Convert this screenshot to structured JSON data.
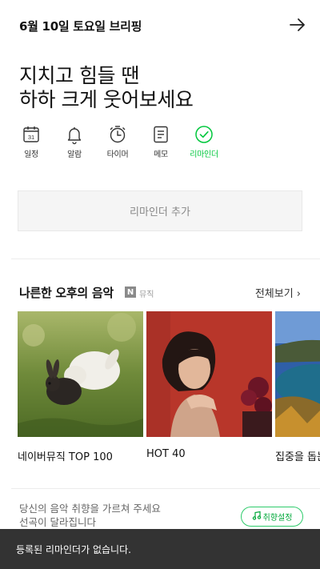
{
  "header": {
    "title": "6월 10일 토요일 브리핑",
    "icon": "arrow-right-icon"
  },
  "greeting": {
    "line1": "지치고 힘들 땐",
    "line2": "하하 크게 웃어보세요"
  },
  "tabs": [
    {
      "label": "일정",
      "icon": "calendar-icon",
      "calendar_day": "31"
    },
    {
      "label": "알람",
      "icon": "bell-icon"
    },
    {
      "label": "타이머",
      "icon": "timer-icon"
    },
    {
      "label": "메모",
      "icon": "memo-icon"
    },
    {
      "label": "리마인더",
      "icon": "check-circle-icon",
      "active": true
    }
  ],
  "reminder": {
    "add_label": "리마인더 추가"
  },
  "music": {
    "title": "나른한 오후의 음악",
    "badge": "N",
    "source": "뮤직",
    "view_all": "전체보기",
    "cards": [
      {
        "title": "네이버뮤직 TOP 100"
      },
      {
        "title": "HOT 40"
      },
      {
        "title": "집중을 돕는"
      }
    ]
  },
  "taste": {
    "line1": "당신의 음악 취향을 가르쳐 주세요",
    "line2": "선곡이 달라집니다",
    "button": "취향설정"
  },
  "toast": {
    "message": "등록된 리마인더가 없습니다."
  },
  "colors": {
    "accent": "#00c73c",
    "toast_bg": "#333333"
  }
}
